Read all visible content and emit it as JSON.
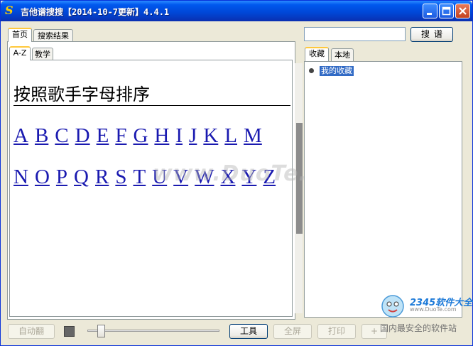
{
  "window": {
    "title": "吉他谱搜搜【2014-10-7更新】4.4.1",
    "app_icon": "S"
  },
  "left_tabs": [
    "首页",
    "搜索结果"
  ],
  "sub_tabs": [
    "A-Z",
    "教学"
  ],
  "content": {
    "heading": "按照歌手字母排序",
    "row1": [
      "A",
      "B",
      "C",
      "D",
      "E",
      "F",
      "G",
      "H",
      "I",
      "J",
      "K",
      "L",
      "M"
    ],
    "row2": [
      "N",
      "O",
      "P",
      "Q",
      "R",
      "S",
      "T",
      "U",
      "V",
      "W",
      "X",
      "Y",
      "Z"
    ],
    "watermark": "www.DuoTe.com"
  },
  "search": {
    "placeholder": "",
    "button": "搜谱"
  },
  "right_tabs": [
    "收藏",
    "本地"
  ],
  "favorites": {
    "root": "我的收藏"
  },
  "bottom": {
    "auto_flip": "自动翻",
    "tools": "工具",
    "fullscreen": "全屏",
    "print": "打印",
    "plus": "+"
  },
  "branding": {
    "logo": "2345软件大全",
    "url": "www.DuoTe.com",
    "slogan": "国内最安全的软件站"
  },
  "colors": {
    "titlebar": "#0054E3",
    "link": "#1A1AB0",
    "selection": "#316AC5",
    "tab_accent": "#FFC83C"
  }
}
